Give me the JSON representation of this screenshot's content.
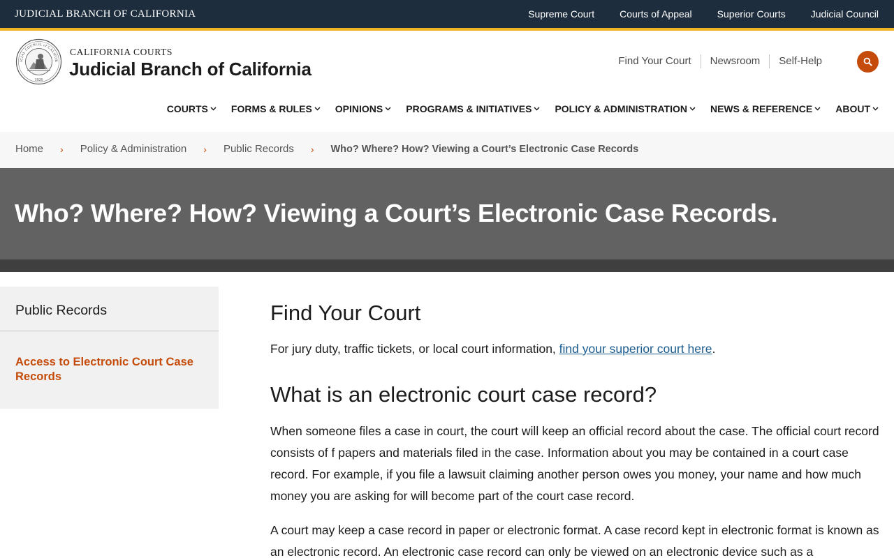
{
  "topbar": {
    "brand": "JUDICIAL BRANCH OF CALIFORNIA",
    "links": [
      "Supreme Court",
      "Courts of Appeal",
      "Superior Courts",
      "Judicial Council"
    ]
  },
  "header": {
    "kicker": "CALIFORNIA COURTS",
    "title": "Judicial Branch of California",
    "utility_links": [
      "Find Your Court",
      "Newsroom",
      "Self-Help"
    ],
    "seal_text": "JUDICIAL COUNCIL of CALIFORNIA",
    "seal_year": "1926"
  },
  "nav": {
    "items": [
      "COURTS",
      "FORMS & RULES",
      "OPINIONS",
      "PROGRAMS & INITIATIVES",
      "POLICY & ADMINISTRATION",
      "NEWS & REFERENCE",
      "ABOUT"
    ]
  },
  "breadcrumb": {
    "items": [
      "Home",
      "Policy & Administration",
      "Public Records"
    ],
    "current": "Who? Where? How? Viewing a Court’s Electronic Case Records"
  },
  "hero": {
    "title": "Who? Where? How? Viewing a Court’s Electronic Case Records."
  },
  "sidebar": {
    "heading": "Public Records",
    "link": "Access to Electronic Court Case Records"
  },
  "content": {
    "section1_title": "Find Your Court",
    "para1_text": "For jury duty, traffic tickets, or local court information, ",
    "para1_link": "find your superior court here",
    "para1_end": ".",
    "section2_title": "What is an electronic court case record?",
    "para2": "When someone files a case in court, the court will keep an official record about the case. The official court record consists of f papers and materials filed in the case. Information about you may be contained in a court case record. For example, if you file a lawsuit claiming another person owes you money, your name and how much money you are asking for will become part of the court case record.",
    "para3": "A court may keep a case record in paper or electronic format. A case record kept in electronic format is known as an electronic record. An electronic case record can only be viewed on an electronic device such as a"
  },
  "colors": {
    "topbar": "#1d2d3d",
    "accent_gold": "#f0b323",
    "accent_orange": "#c54b0a",
    "hero": "#626262",
    "hero_band": "#3f3f3f",
    "link_blue": "#1a5b8e"
  }
}
